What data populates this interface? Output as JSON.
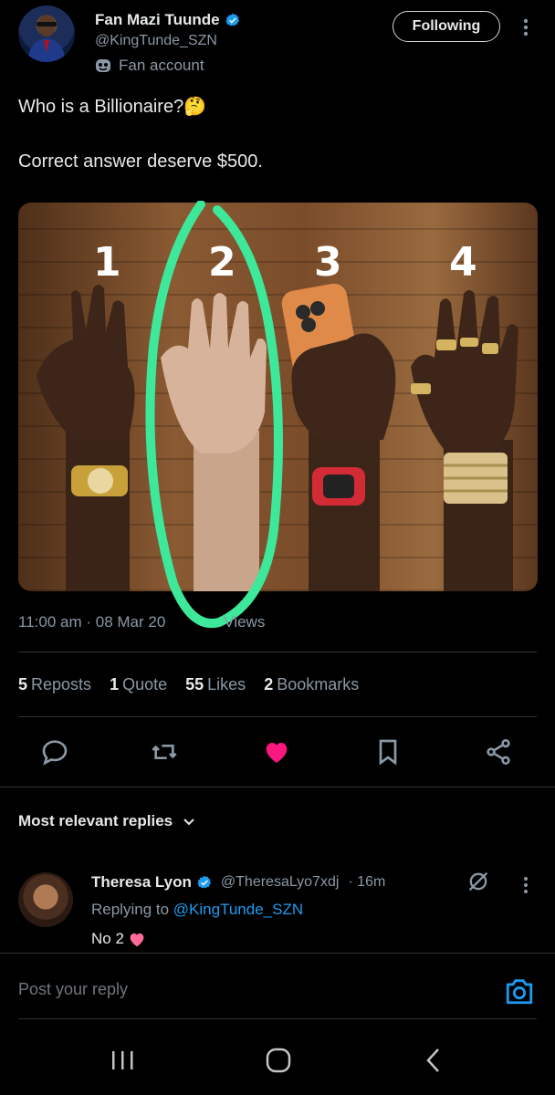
{
  "author": {
    "name": "Fan Mazi Tuunde",
    "handle": "@KingTunde_SZN",
    "label": "Fan account",
    "follow_label": "Following"
  },
  "post": {
    "line1": "Who is a Billionaire?",
    "line1_emoji": "🤔",
    "line2": "Correct answer deserve $500.",
    "image_numbers": [
      "1",
      "2",
      "3",
      "4"
    ],
    "meta_time": "11:00 am",
    "meta_date": "08 Mar 20",
    "meta_views_label": "Views"
  },
  "stats": [
    {
      "count": "5",
      "label": "Reposts"
    },
    {
      "count": "1",
      "label": "Quote"
    },
    {
      "count": "55",
      "label": "Likes"
    },
    {
      "count": "2",
      "label": "Bookmarks"
    }
  ],
  "actions": [
    "reply-icon",
    "repost-icon",
    "like-icon",
    "bookmark-icon",
    "share-icon"
  ],
  "colors": {
    "like": "#f91880",
    "link": "#1d9bf0",
    "verified": "#1d9bf0",
    "circle": "#3ee89a"
  },
  "replies": {
    "sort_label": "Most relevant replies",
    "items": [
      {
        "name": "Theresa Lyon",
        "handle": "@TheresaLyo7xdj",
        "time": "· 16m",
        "replying_prefix": "Replying to",
        "replying_to": "@KingTunde_SZN",
        "text": "No 2"
      }
    ]
  },
  "compose": {
    "placeholder": "Post your reply"
  }
}
